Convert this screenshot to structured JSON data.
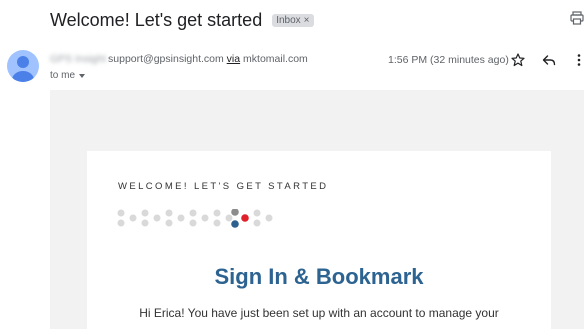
{
  "email": {
    "subject": "Welcome! Let's get started",
    "label": "Inbox",
    "label_close": "×",
    "sender_name": "GPS Insight",
    "sender_email": "support@gpsinsight.com",
    "via_word": "via",
    "via_domain": "mktomail.com",
    "recipient": "to me",
    "time": "1:56 PM (32 minutes ago)"
  },
  "icons": {
    "print": "print-icon",
    "star": "star-icon",
    "reply": "reply-icon",
    "more": "more-vert-icon",
    "caret": "chevron-down-icon",
    "avatar": "person-icon"
  },
  "content": {
    "eyebrow": "WELCOME! LET'S GET STARTED",
    "headline": "Sign In & Bookmark",
    "body": "Hi Erica! You have just been set up with an account to manage your",
    "body_cont": "...."
  },
  "colors": {
    "headline": "#2d6391",
    "dot_gray": "#d9d9d9",
    "dot_dark_gray": "#8c8c8c",
    "dot_red": "#e0202b",
    "dot_blue": "#2d5f8f",
    "avatar_bg": "#a0c3ff",
    "avatar_fg": "#4a80e8",
    "label_bg": "#dadce0"
  }
}
